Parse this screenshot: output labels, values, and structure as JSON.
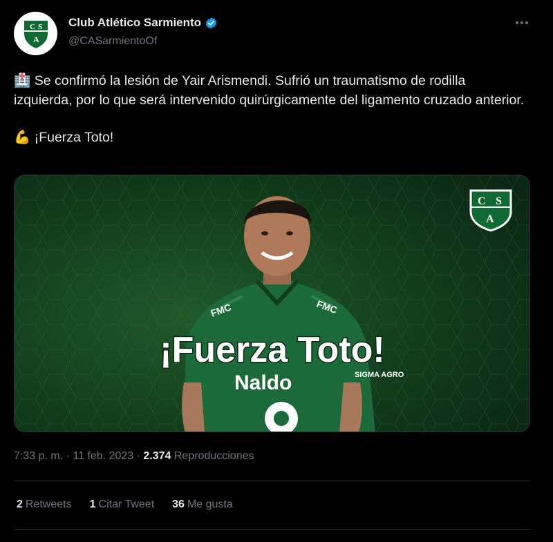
{
  "account": {
    "display_name": "Club Atlético Sarmiento",
    "handle": "@CASarmientoOf",
    "verified": true,
    "avatar_icon": "sarmiento-crest-icon"
  },
  "tweet": {
    "line1_emoji": "🏥",
    "line1_text": " Se confirmó la lesión de Yair Arismendi. Sufrió un traumatismo de rodilla izquierda, por lo que será intervenido quirúrgicamente del ligamento cruzado anterior.",
    "line2_emoji": "💪",
    "line2_text": " ¡Fuerza Toto!"
  },
  "media": {
    "headline": "¡Fuerza Toto!",
    "crest_letters": [
      "C",
      "S",
      "A"
    ],
    "sponsors": [
      "FMC",
      "Naldo",
      "SIGMA AGRO"
    ]
  },
  "meta": {
    "time": "7:33 p. m.",
    "separator": " · ",
    "date": "11 feb. 2023",
    "views_count": "2.374",
    "views_label": " Reproducciones"
  },
  "stats": {
    "retweets_count": "2",
    "retweets_label": "Retweets",
    "quotes_count": "1",
    "quotes_label": "Citar Tweet",
    "likes_count": "36",
    "likes_label": "Me gusta"
  },
  "colors": {
    "background": "#000000",
    "text": "#e7e9ea",
    "secondary": "#71767b",
    "verified": "#1d9bf0",
    "club_green": "#0e5a2e"
  }
}
